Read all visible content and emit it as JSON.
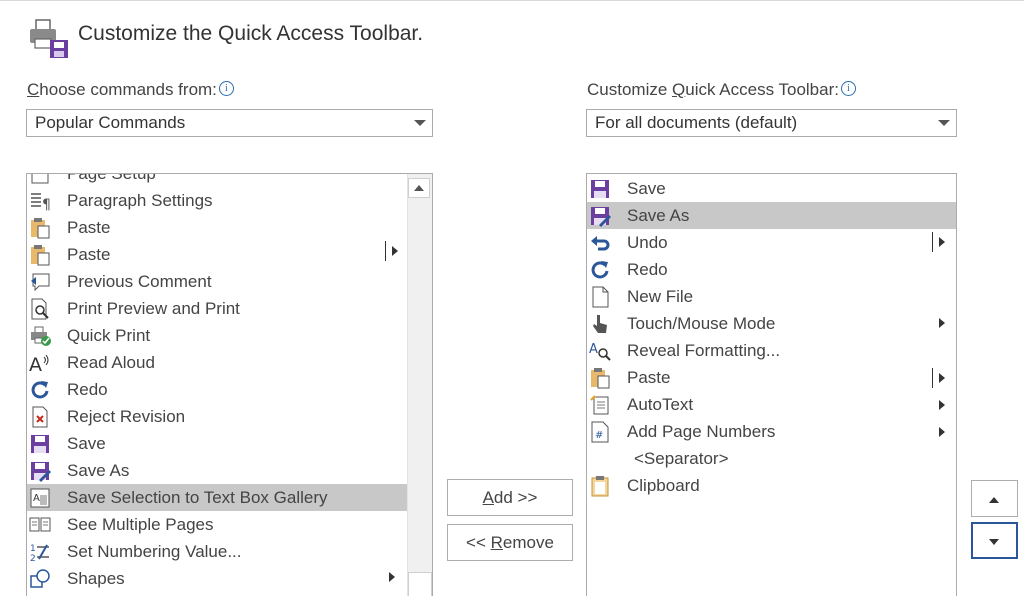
{
  "header": {
    "title": "Customize the Quick Access Toolbar."
  },
  "left": {
    "label_prefix": "C",
    "label_rest": "hoose commands from:",
    "info": "i",
    "dropdown_value": "Popular Commands",
    "items": [
      {
        "label": "Page Setup",
        "icon": "page-setup-icon"
      },
      {
        "label": "Paragraph Settings",
        "icon": "paragraph-settings-icon"
      },
      {
        "label": "Paste",
        "icon": "paste-icon"
      },
      {
        "label": "Paste",
        "icon": "paste-icon"
      },
      {
        "label": "Previous Comment",
        "icon": "previous-comment-icon"
      },
      {
        "label": "Print Preview and Print",
        "icon": "print-preview-icon"
      },
      {
        "label": "Quick Print",
        "icon": "quick-print-icon"
      },
      {
        "label": "Read Aloud",
        "icon": "read-aloud-icon"
      },
      {
        "label": "Redo",
        "icon": "redo-icon"
      },
      {
        "label": "Reject Revision",
        "icon": "reject-revision-icon"
      },
      {
        "label": "Save",
        "icon": "save-icon"
      },
      {
        "label": "Save As",
        "icon": "save-as-icon"
      },
      {
        "label": "Save Selection to Text Box Gallery",
        "icon": "text-box-gallery-icon"
      },
      {
        "label": "See Multiple Pages",
        "icon": "multiple-pages-icon"
      },
      {
        "label": "Set Numbering Value...",
        "icon": "numbering-icon"
      },
      {
        "label": "Shapes",
        "icon": "shapes-icon"
      }
    ]
  },
  "right": {
    "label_prefix": "Customize ",
    "label_underlined": "Q",
    "label_rest": "uick Access Toolbar:",
    "info": "i",
    "dropdown_value": "For all documents (default)",
    "items": [
      {
        "label": "Save",
        "icon": "save-icon"
      },
      {
        "label": "Save As",
        "icon": "save-as-icon"
      },
      {
        "label": "Undo",
        "icon": "undo-icon"
      },
      {
        "label": "Redo",
        "icon": "redo-icon"
      },
      {
        "label": "New File",
        "icon": "new-file-icon"
      },
      {
        "label": "Touch/Mouse Mode",
        "icon": "touch-mode-icon"
      },
      {
        "label": "Reveal Formatting...",
        "icon": "reveal-formatting-icon"
      },
      {
        "label": "Paste",
        "icon": "paste-icon"
      },
      {
        "label": "AutoText",
        "icon": "autotext-icon"
      },
      {
        "label": "Add Page Numbers",
        "icon": "page-numbers-icon"
      },
      {
        "label": "<Separator>",
        "icon": ""
      },
      {
        "label": "Clipboard",
        "icon": "clipboard-icon"
      }
    ]
  },
  "buttons": {
    "add_underlined": "A",
    "add_rest": "dd >>",
    "remove_prefix": "<< ",
    "remove_underlined": "R",
    "remove_rest": "emove"
  },
  "colors": {
    "accent": "#2b579a",
    "save_purple": "#6b3fa0",
    "selection": "#c8c8c8"
  }
}
